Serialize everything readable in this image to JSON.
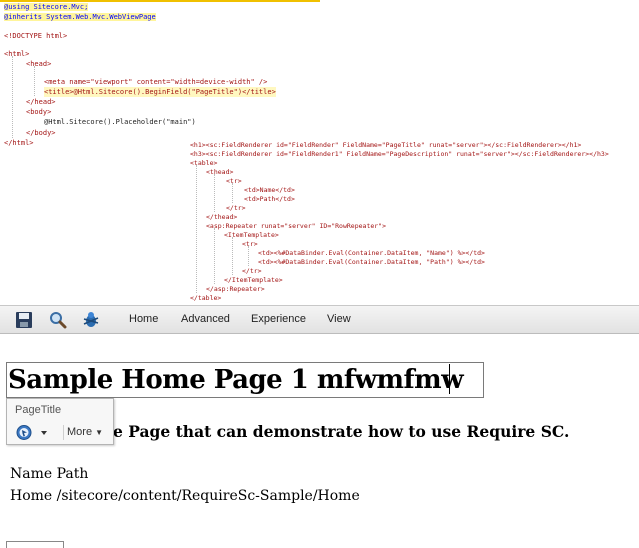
{
  "code": {
    "lines": [
      "@using Sitecore.Mvc;",
      "@inherits System.Web.Mvc.WebViewPage",
      "<!DOCTYPE html>",
      "<html>",
      "<head>",
      "<meta name=\"viewport\" content=\"width=device-width\" />",
      "<title>@Html.Sitecore().BeginField(\"PageTitle\")</title>",
      "</head>",
      "<body>",
      "@Html.Sitecore().Placeholder(\"main\")",
      "</body>",
      "</html>"
    ],
    "right_lines": [
      "<h1><sc:FieldRenderer id=\"FieldRender\" FieldName=\"PageTitle\" runat=\"server\"></sc:FieldRenderer></h1>",
      "<h3><sc:FieldRenderer id=\"FieldRender1\" FieldName=\"PageDescription\" runat=\"server\"></sc:FieldRenderer></h3>",
      "<table>",
      "<thead>",
      "<tr>",
      "<td>Name</td>",
      "<td>Path</td>",
      "</tr>",
      "</thead>",
      "<asp:Repeater runat=\"server\" ID=\"RowRepeater\">",
      "<ItemTemplate>",
      "<tr>",
      "<td><%#DataBinder.Eval(Container.DataItem, \"Name\") %></td>",
      "<td><%#DataBinder.Eval(Container.DataItem, \"Path\") %></td>",
      "</tr>",
      "</ItemTemplate>",
      "</asp:Repeater>",
      "</table>"
    ]
  },
  "ribbon": {
    "tabs": [
      "Home",
      "Advanced",
      "Experience",
      "View"
    ],
    "icons": [
      "save-icon",
      "search-icon",
      "debug-icon"
    ]
  },
  "page": {
    "title": "Sample Home Page 1 mfwmfmw",
    "description_visible": "e Page that can demonstrate how to use Require SC.",
    "table": {
      "headers": [
        "Name",
        "Path"
      ],
      "rows": [
        [
          "Home",
          "/sitecore/content/RequireSc-Sample/Home"
        ]
      ]
    }
  },
  "popup": {
    "field_name": "PageTitle",
    "more_label": "More"
  },
  "colors": {
    "ribbon_bg": "#e8e8e8",
    "highlight": "#fff59b"
  }
}
